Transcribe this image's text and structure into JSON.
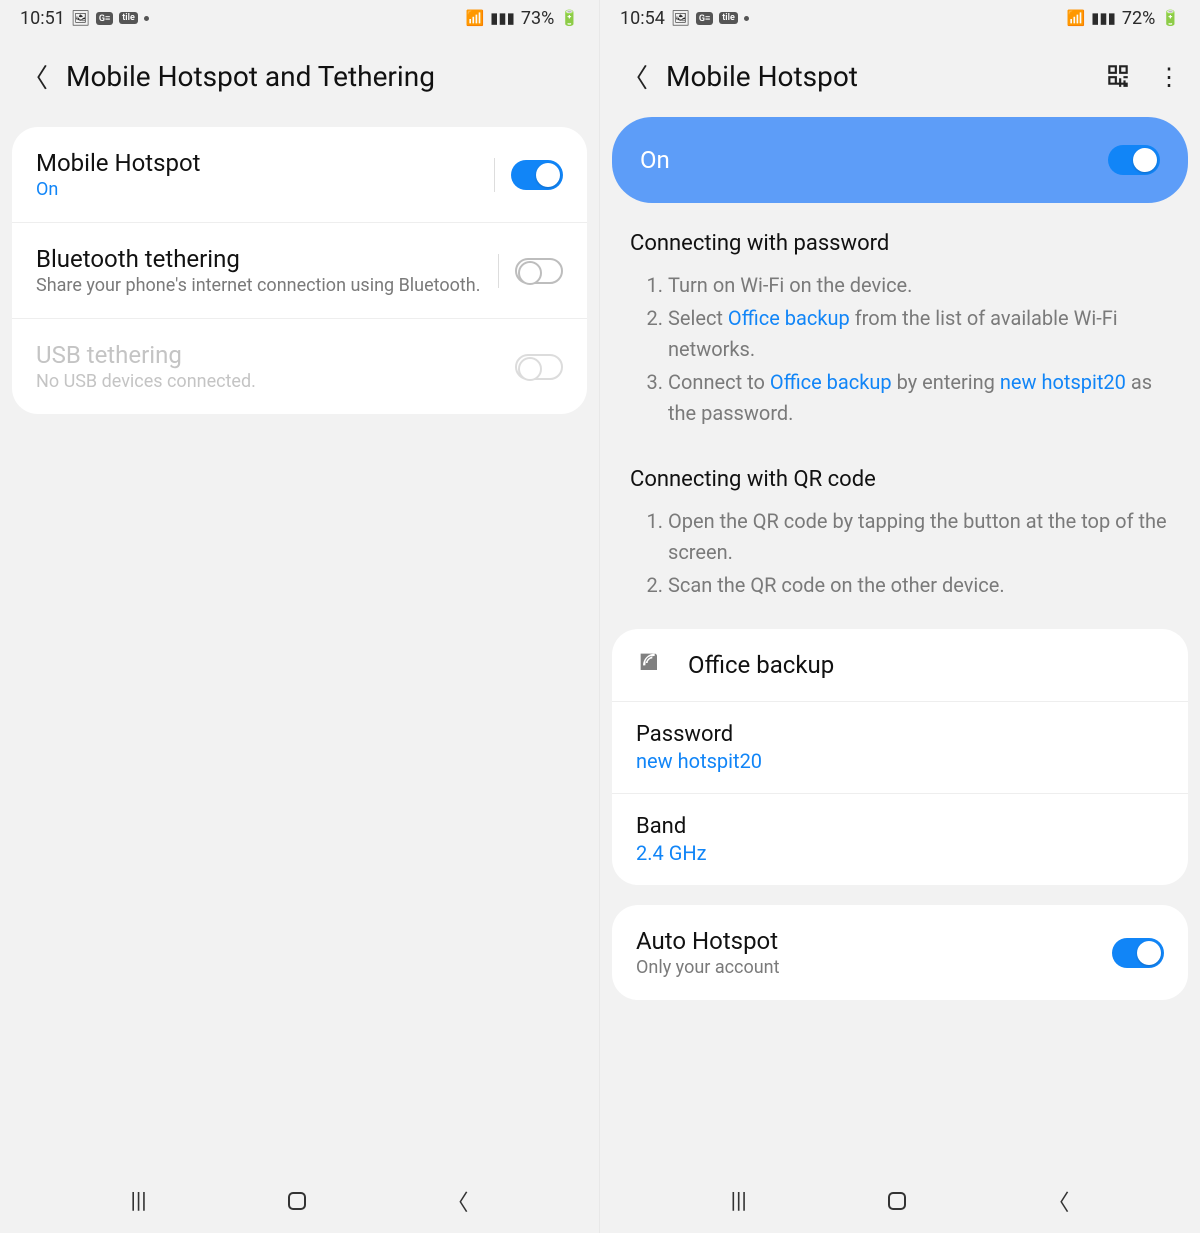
{
  "left": {
    "status": {
      "time": "10:51",
      "battery": "73%"
    },
    "title": "Mobile Hotspot and Tethering",
    "rows": [
      {
        "title": "Mobile Hotspot",
        "sub": "On",
        "toggle": "on"
      },
      {
        "title": "Bluetooth tethering",
        "sub": "Share your phone's internet connection using Bluetooth.",
        "toggle": "off"
      },
      {
        "title": "USB tethering",
        "sub": "No USB devices connected.",
        "toggle": "off",
        "disabled": true
      }
    ]
  },
  "right": {
    "status": {
      "time": "10:54",
      "battery": "72%"
    },
    "title": "Mobile Hotspot",
    "pill": {
      "label": "On",
      "toggle": "on"
    },
    "section_pw": {
      "heading": "Connecting with password",
      "step1": "Turn on Wi-Fi on the device.",
      "step2_a": "Select ",
      "step2_hl": "Office backup",
      "step2_b": " from the list of available Wi-Fi networks.",
      "step3_a": "Connect to ",
      "step3_hl1": "Office backup",
      "step3_b": " by entering ",
      "step3_hl2": "new hotspit20",
      "step3_c": " as the password."
    },
    "section_qr": {
      "heading": "Connecting with QR code",
      "step1": "Open the QR code by tapping the button at the top of the screen.",
      "step2": "Scan the QR code on the other device."
    },
    "hotspot": {
      "name": "Office backup",
      "password_label": "Password",
      "password_value": "new hotspit20",
      "band_label": "Band",
      "band_value": "2.4 GHz"
    },
    "auto": {
      "title": "Auto Hotspot",
      "sub": "Only your account",
      "toggle": "on"
    }
  }
}
